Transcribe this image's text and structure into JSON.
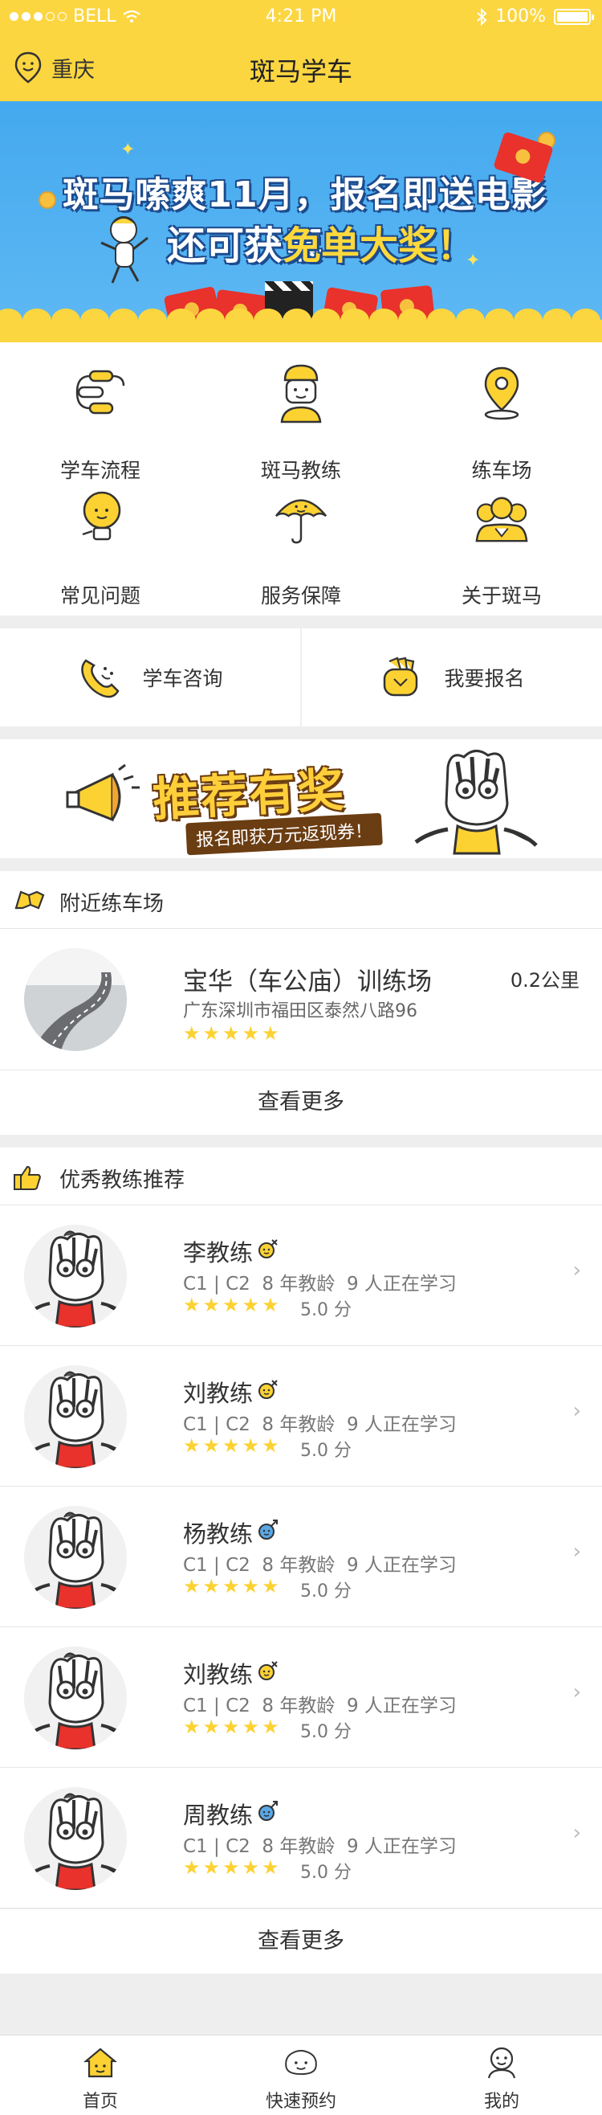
{
  "status_bar": {
    "carrier": "BELL",
    "time": "4:21 PM",
    "battery": "100%"
  },
  "header": {
    "city": "重庆",
    "title": "斑马学车"
  },
  "banner": {
    "line1": "斑马嗦爽11月，报名即送电影票",
    "line2_prefix": "还可获",
    "line2_highlight": "免单大奖！"
  },
  "menu": [
    {
      "label": "学车流程",
      "icon": "flow-icon"
    },
    {
      "label": "斑马教练",
      "icon": "coach-icon"
    },
    {
      "label": "练车场",
      "icon": "location-pin-icon"
    },
    {
      "label": "常见问题",
      "icon": "lightbulb-icon"
    },
    {
      "label": "服务保障",
      "icon": "umbrella-icon"
    },
    {
      "label": "关于斑马",
      "icon": "team-icon"
    }
  ],
  "actions": {
    "consult": "学车咨询",
    "signup": "我要报名"
  },
  "recommend": {
    "title": "推荐有奖",
    "subtitle": "报名即获万元返现券！"
  },
  "nearby": {
    "heading": "附近练车场",
    "field": {
      "name": "宝华（车公庙）训练场",
      "distance": "0.2公里",
      "address": "广东深圳市福田区泰然八路96",
      "rating": 5
    },
    "more": "查看更多"
  },
  "coaches": {
    "heading": "优秀教练推荐",
    "items": [
      {
        "name": "李教练",
        "gender": "female",
        "license": "C1 | C2",
        "years": "8 年教龄",
        "learning": "9 人正在学习",
        "score": "5.0 分"
      },
      {
        "name": "刘教练",
        "gender": "female",
        "license": "C1 | C2",
        "years": "8 年教龄",
        "learning": "9 人正在学习",
        "score": "5.0 分"
      },
      {
        "name": "杨教练",
        "gender": "male",
        "license": "C1 | C2",
        "years": "8 年教龄",
        "learning": "9 人正在学习",
        "score": "5.0 分"
      },
      {
        "name": "刘教练",
        "gender": "female",
        "license": "C1 | C2",
        "years": "8 年教龄",
        "learning": "9 人正在学习",
        "score": "5.0 分"
      },
      {
        "name": "周教练",
        "gender": "male",
        "license": "C1 | C2",
        "years": "8 年教龄",
        "learning": "9 人正在学习",
        "score": "5.0 分"
      }
    ],
    "more": "查看更多"
  },
  "tabbar": [
    {
      "label": "首页",
      "icon": "home-icon"
    },
    {
      "label": "快速预约",
      "icon": "quick-book-icon"
    },
    {
      "label": "我的",
      "icon": "profile-icon"
    }
  ],
  "colors": {
    "accent": "#fcd640",
    "star": "#fcd233",
    "female": "#fcd233",
    "male": "#5aa7e6"
  }
}
